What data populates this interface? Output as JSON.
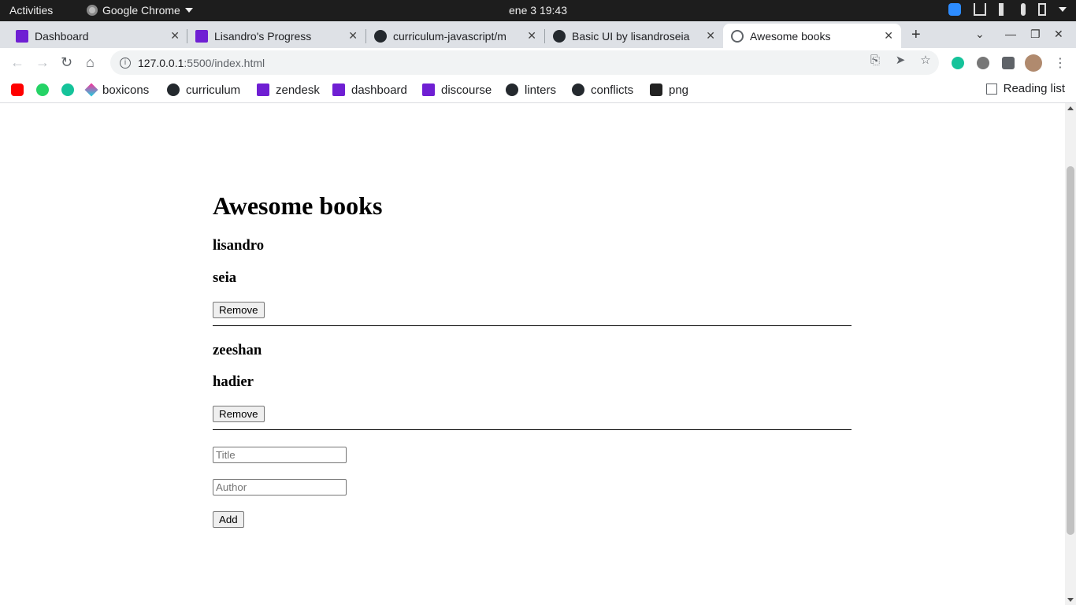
{
  "system_bar": {
    "activities": "Activities",
    "app_name": "Google Chrome",
    "clock": "ene 3  19:43"
  },
  "tabs": [
    {
      "label": "Dashboard",
      "favicon": "microverse-icon"
    },
    {
      "label": "Lisandro's Progress",
      "favicon": "microverse-icon"
    },
    {
      "label": "curriculum-javascript/m",
      "favicon": "github-icon"
    },
    {
      "label": "Basic UI by lisandroseia",
      "favicon": "github-icon"
    },
    {
      "label": "Awesome books",
      "favicon": "globe-icon",
      "active": true
    }
  ],
  "address_bar": {
    "host": "127.0.0.1",
    "path": ":5500/index.html"
  },
  "bookmarks": [
    {
      "label": "",
      "icon": "youtube-icon"
    },
    {
      "label": "",
      "icon": "whatsapp-icon"
    },
    {
      "label": "",
      "icon": "grammarly-icon"
    },
    {
      "label": "boxicons",
      "icon": "boxicons-icon"
    },
    {
      "label": "curriculum",
      "icon": "github-icon"
    },
    {
      "label": "zendesk",
      "icon": "microverse-icon"
    },
    {
      "label": "dashboard",
      "icon": "microverse-icon"
    },
    {
      "label": "discourse",
      "icon": "microverse-icon"
    },
    {
      "label": "linters",
      "icon": "github-icon"
    },
    {
      "label": "conflicts",
      "icon": "github-icon"
    },
    {
      "label": "png",
      "icon": "png-icon"
    }
  ],
  "reading_list": "Reading list",
  "page": {
    "heading": "Awesome books",
    "books": [
      {
        "title": "lisandro",
        "author": "seia",
        "remove_label": "Remove"
      },
      {
        "title": "zeeshan",
        "author": "hadier",
        "remove_label": "Remove"
      }
    ],
    "form": {
      "title_placeholder": "Title",
      "author_placeholder": "Author",
      "add_label": "Add"
    }
  }
}
